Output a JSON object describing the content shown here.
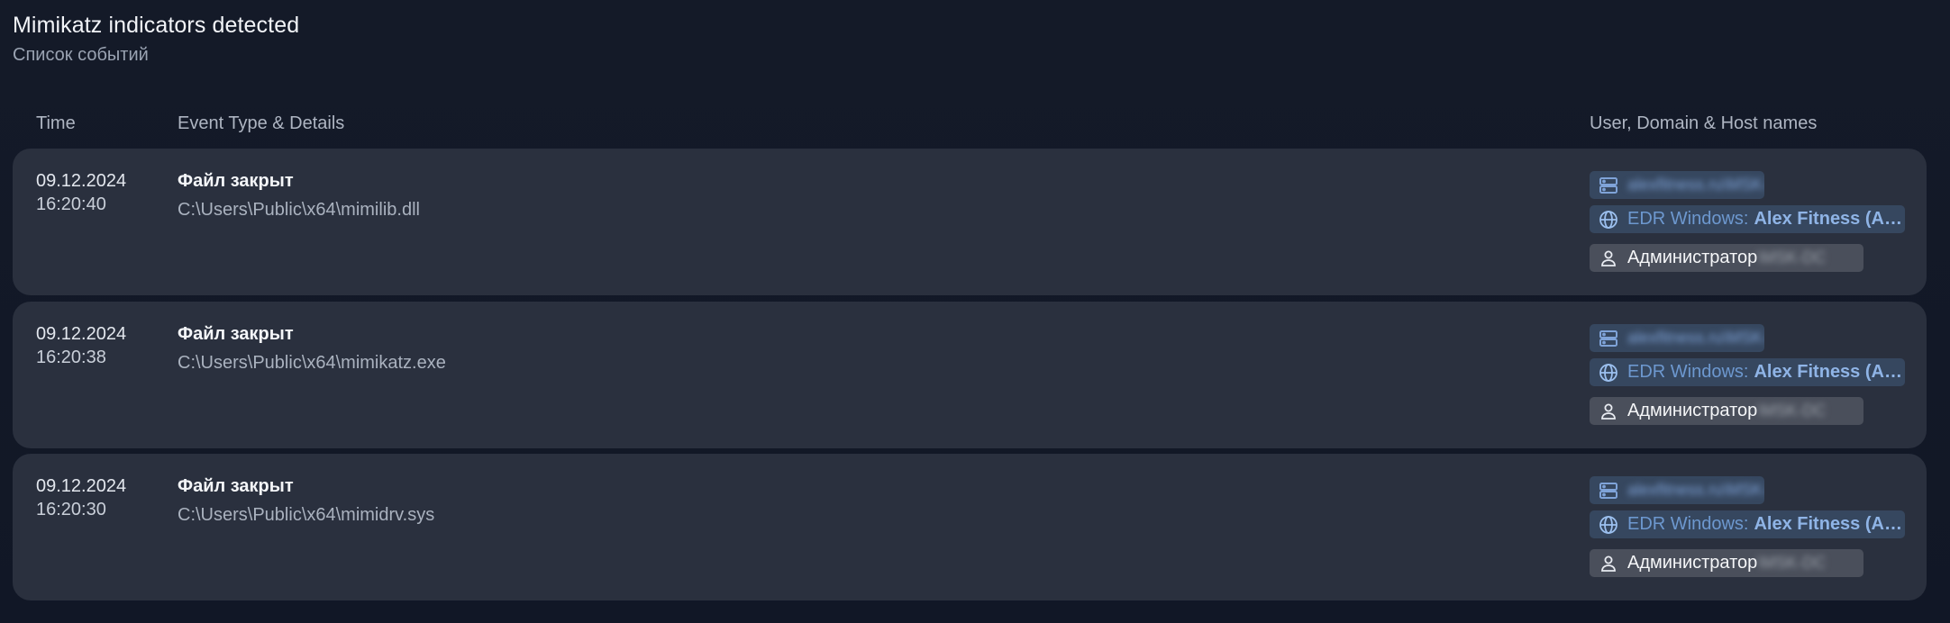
{
  "header": {
    "title": "Mimikatz indicators detected",
    "subtitle": "Список событий"
  },
  "columns": {
    "time": "Time",
    "details": "Event Type & Details",
    "user": "User, Domain & Host names"
  },
  "events": [
    {
      "date": "09.12.2024",
      "time": "16:20:40",
      "event_type": "Файл закрыт",
      "path": "C:\\Users\\Public\\x64\\mimilib.dll",
      "host_icon": "server-icon",
      "host": "alexfitness.ru\\MSK-DC",
      "domain_icon": "globe-icon",
      "domain_prefix": "EDR Windows:",
      "domain_name": "Alex Fitness (A…",
      "user_icon": "user-icon",
      "user": "Администратор",
      "user_suffix": "\\MSK-DC"
    },
    {
      "date": "09.12.2024",
      "time": "16:20:38",
      "event_type": "Файл закрыт",
      "path": "C:\\Users\\Public\\x64\\mimikatz.exe",
      "host_icon": "server-icon",
      "host": "alexfitness.ru\\MSK-DC",
      "domain_icon": "globe-icon",
      "domain_prefix": "EDR Windows:",
      "domain_name": "Alex Fitness (A…",
      "user_icon": "user-icon",
      "user": "Администратор",
      "user_suffix": "\\MSK-DC"
    },
    {
      "date": "09.12.2024",
      "time": "16:20:30",
      "event_type": "Файл закрыт",
      "path": "C:\\Users\\Public\\x64\\mimidrv.sys",
      "host_icon": "server-icon",
      "host": "alexfitness.ru\\MSK-DC",
      "domain_icon": "globe-icon",
      "domain_prefix": "EDR Windows:",
      "domain_name": "Alex Fitness (A…",
      "user_icon": "user-icon",
      "user": "Администратор",
      "user_suffix": "\\MSK-DC"
    }
  ],
  "colors": {
    "background": "#131927",
    "row": "#2a303e",
    "chip_blue": "#36475f",
    "chip_grey": "#4a4f5b",
    "accent": "#8fb4e6"
  }
}
